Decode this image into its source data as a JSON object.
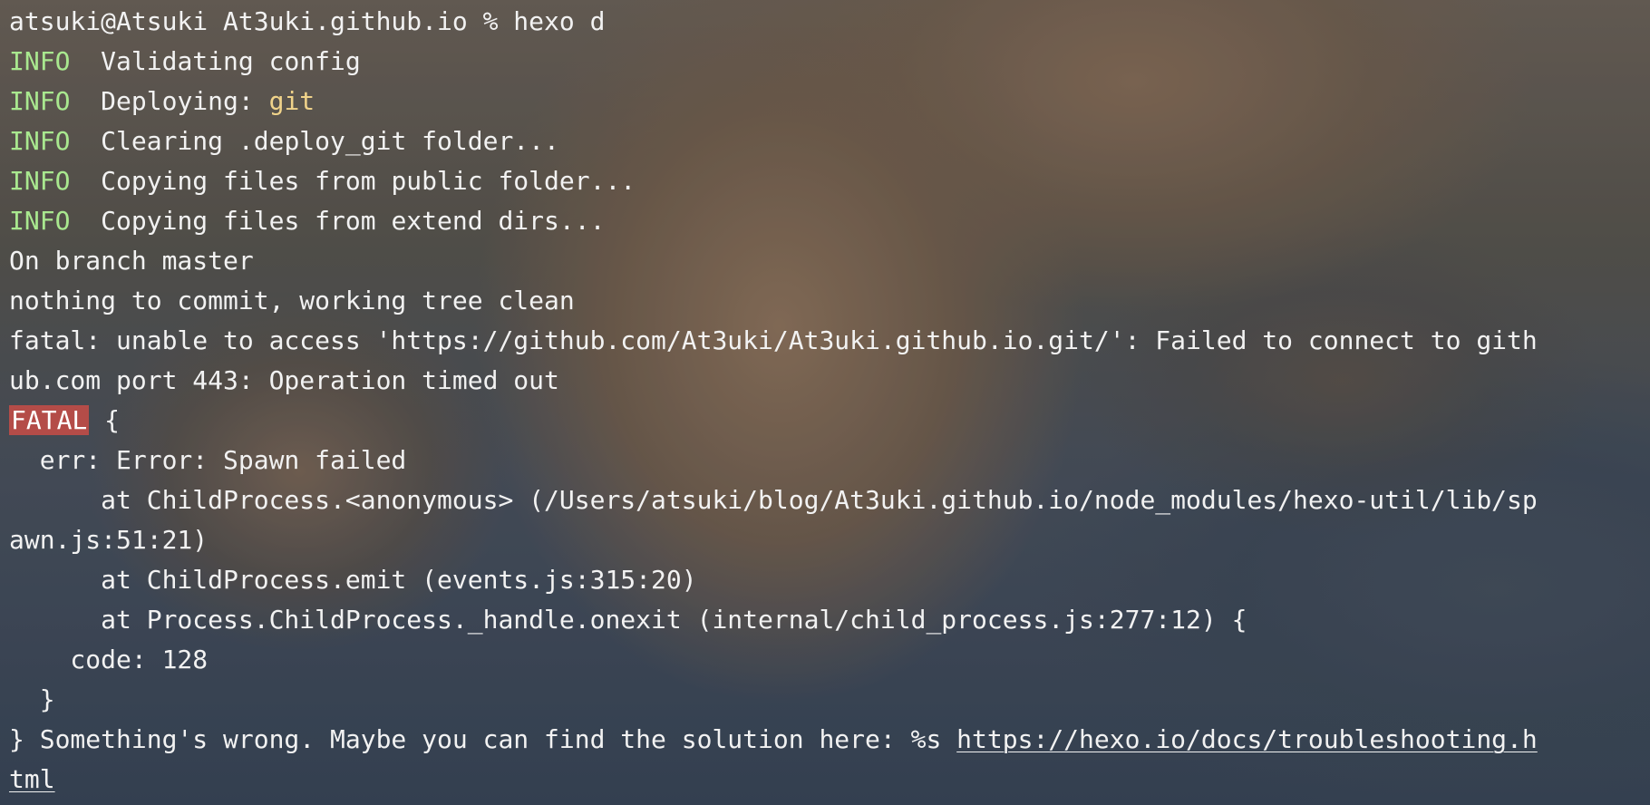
{
  "prompt": "atsuki@Atsuki At3uki.github.io % hexo d",
  "log_lines": [
    {
      "tag": "INFO",
      "text": "Validating config"
    },
    {
      "tag": "INFO",
      "text": "Deploying:",
      "highlight": "git"
    },
    {
      "tag": "INFO",
      "text": "Clearing .deploy_git folder..."
    },
    {
      "tag": "INFO",
      "text": "Copying files from public folder..."
    },
    {
      "tag": "INFO",
      "text": "Copying files from extend dirs..."
    }
  ],
  "git_output": [
    "On branch master",
    "nothing to commit, working tree clean",
    "fatal: unable to access 'https://github.com/At3uki/At3uki.github.io.git/': Failed to connect to gith",
    "ub.com port 443: Operation timed out"
  ],
  "fatal_block": {
    "tag": "FATAL",
    "open_brace": " {",
    "lines": [
      "  err: Error: Spawn failed",
      "      at ChildProcess.<anonymous> (/Users/atsuki/blog/At3uki.github.io/node_modules/hexo-util/lib/sp",
      "awn.js:51:21)",
      "      at ChildProcess.emit (events.js:315:20)",
      "      at Process.ChildProcess._handle.onexit (internal/child_process.js:277:12) {",
      "    code: 128",
      "  }"
    ]
  },
  "footer": {
    "prefix": "} Something's wrong. Maybe you can find the solution here: %s ",
    "link_part1": "https://hexo.io/docs/troubleshooting.h",
    "link_part2": "tml"
  },
  "colors": {
    "info": "#a9e88f",
    "highlight": "#f0d38a",
    "fatal_bg": "#b44c48",
    "text": "#f2f2f2"
  }
}
